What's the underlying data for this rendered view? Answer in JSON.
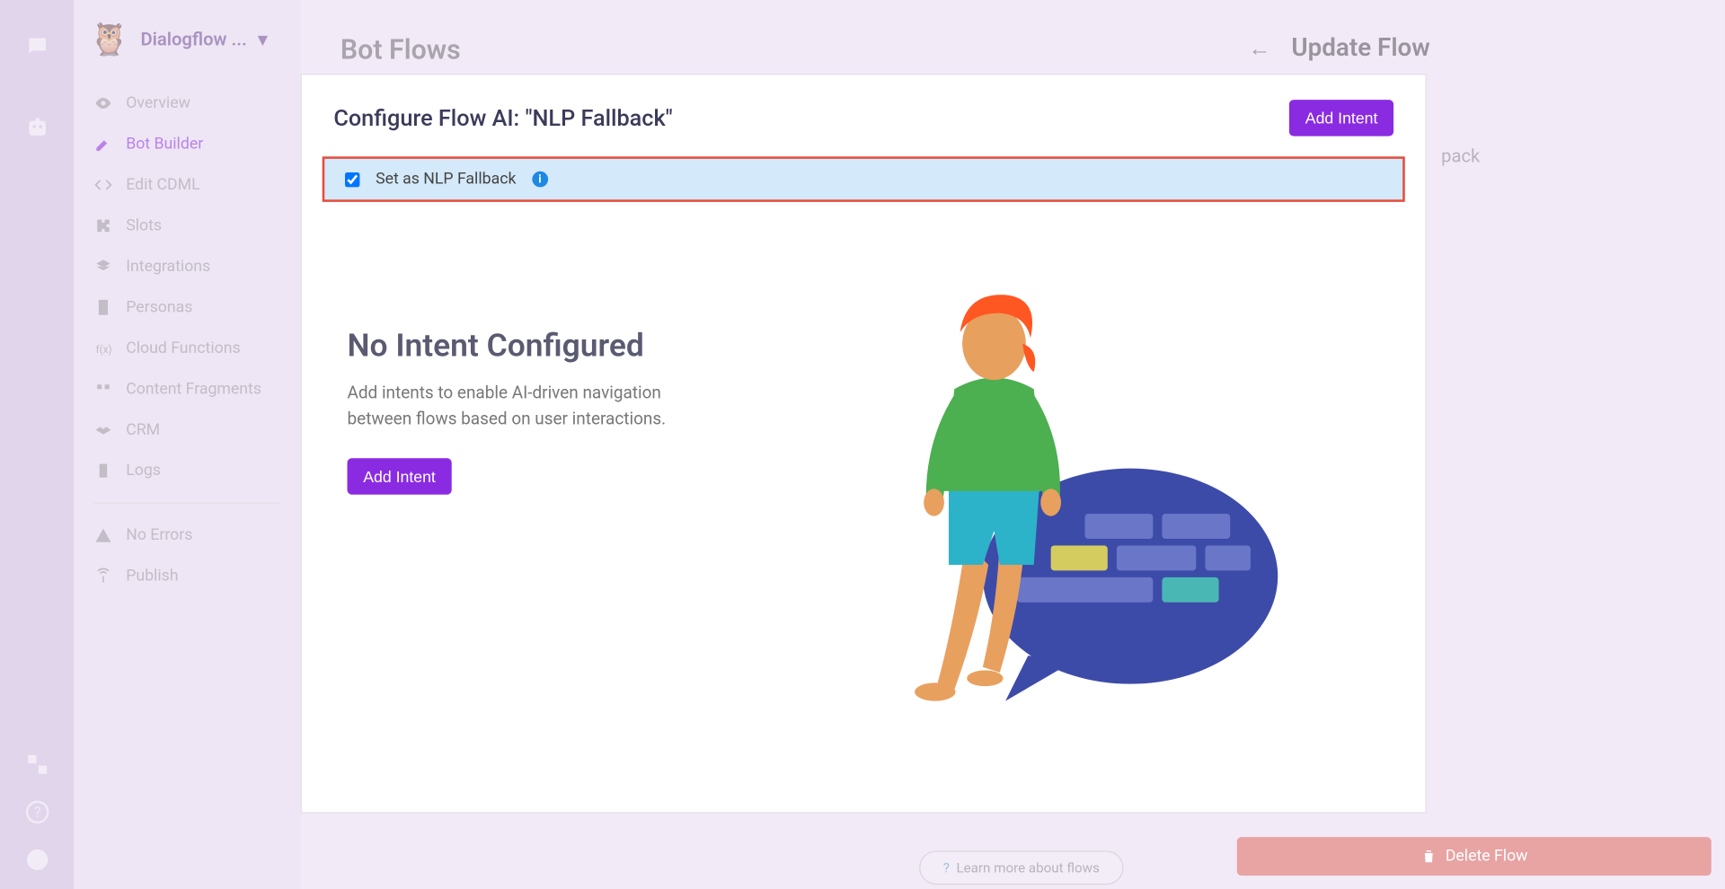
{
  "project": {
    "name": "Dialogflow ..."
  },
  "sidebar": [
    {
      "label": "Overview"
    },
    {
      "label": "Bot Builder"
    },
    {
      "label": "Edit CDML"
    },
    {
      "label": "Slots"
    },
    {
      "label": "Integrations"
    },
    {
      "label": "Personas"
    },
    {
      "label": "Cloud Functions"
    },
    {
      "label": "Content Fragments"
    },
    {
      "label": "CRM"
    },
    {
      "label": "Logs"
    }
  ],
  "sidebar_secondary": [
    {
      "label": "No Errors"
    },
    {
      "label": "Publish"
    }
  ],
  "page_title": "Bot Flows",
  "learn_more": "Learn more about flows",
  "right_panel": {
    "title": "Update Flow",
    "breadcrumb": "pack"
  },
  "delete_label": "Delete Flow",
  "modal": {
    "title": "Configure Flow AI: \"NLP Fallback\"",
    "add_intent": "Add Intent",
    "fallback_label": "Set as NLP Fallback",
    "empty_title": "No Intent Configured",
    "empty_desc": "Add intents to enable AI-driven navigation between flows based on user interactions.",
    "empty_cta": "Add Intent"
  }
}
